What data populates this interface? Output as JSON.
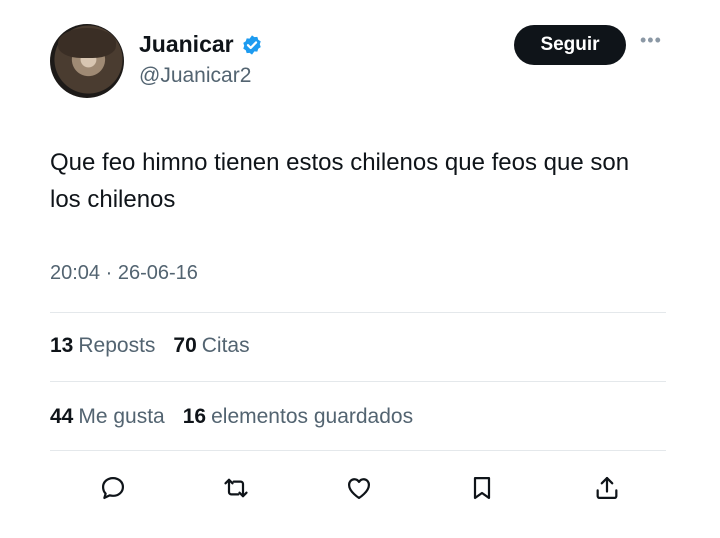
{
  "author": {
    "name": "Juanicar",
    "handle": "@Juanicar2",
    "verified": true
  },
  "header": {
    "follow_label": "Seguir",
    "more_icon": "more-icon"
  },
  "tweet": {
    "text": "Que feo himno tienen estos chilenos que feos que son los chilenos",
    "time": "20:04",
    "separator": "·",
    "date": "26-06-16"
  },
  "stats": {
    "reposts_count": "13",
    "reposts_label": "Reposts",
    "quotes_count": "70",
    "quotes_label": "Citas",
    "likes_count": "44",
    "likes_label": "Me gusta",
    "bookmarks_count": "16",
    "bookmarks_label": "elementos guardados"
  },
  "actions": [
    "reply-icon",
    "repost-icon",
    "like-icon",
    "bookmark-icon",
    "share-icon"
  ],
  "colors": {
    "text": "#0f1419",
    "secondary": "#536471",
    "verified": "#1d9bf0",
    "button_bg": "#0f1419",
    "divider": "#e4e8eb"
  }
}
